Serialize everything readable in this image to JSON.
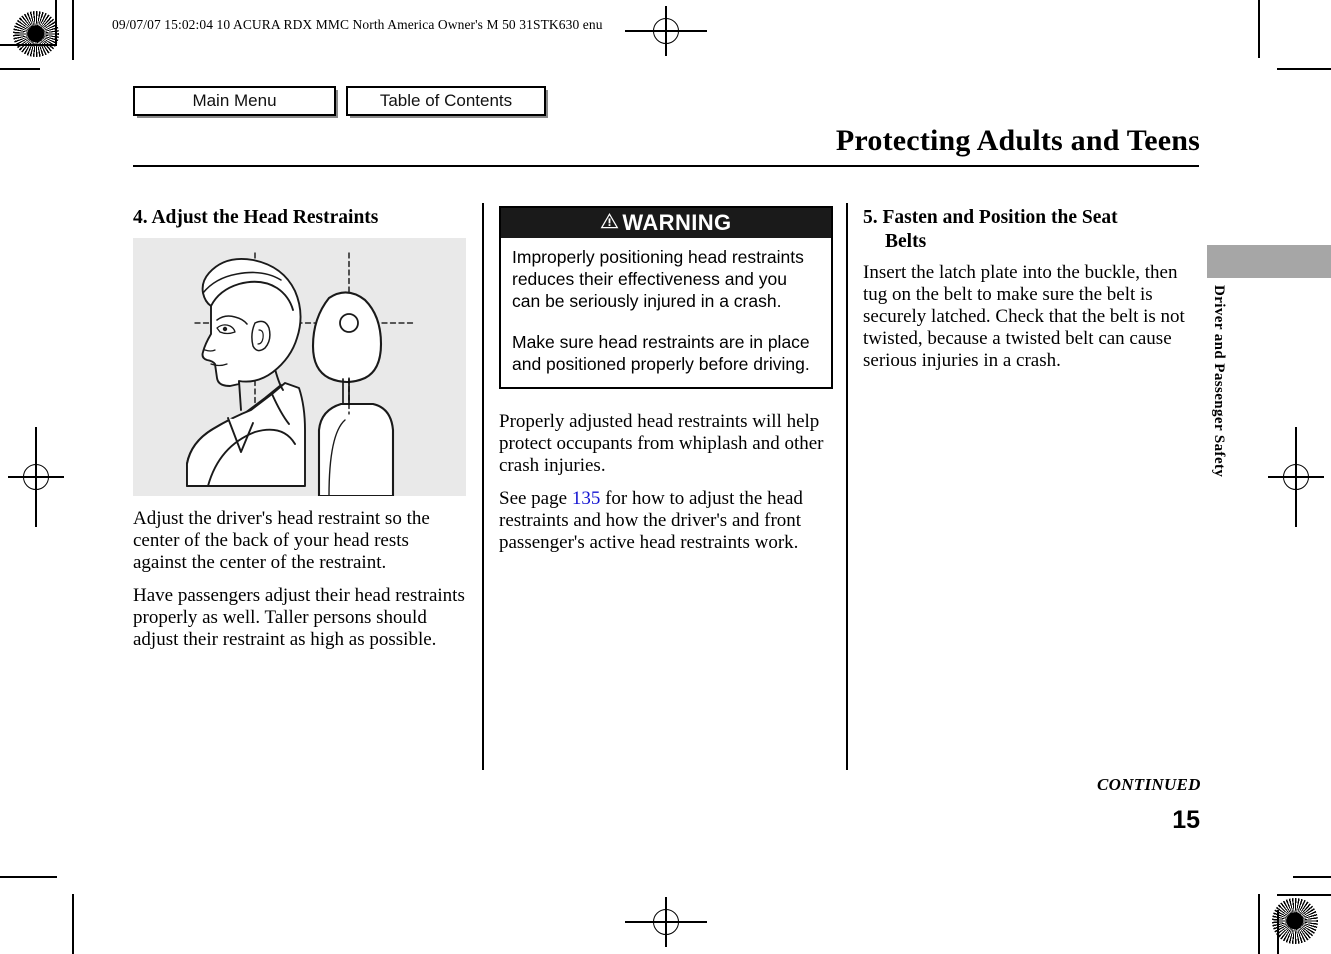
{
  "header": {
    "print_info": "09/07/07 15:02:04    10 ACURA RDX MMC North America Owner's M 50 31STK630 enu"
  },
  "nav": {
    "main_menu_label": "Main Menu",
    "table_of_contents_label": "Table of Contents"
  },
  "page": {
    "title": "Protecting Adults and Teens",
    "number": "15",
    "continued_label": "CONTINUED",
    "side_tab_label": "Driver and Passenger Safety",
    "side_tab_color": "#a6a6a6"
  },
  "left_column": {
    "heading_number": "4.",
    "heading_text": "Adjust the Head Restraints",
    "illustration_name": "head-restraint-alignment-diagram",
    "illustration_bg": "#e9e9e9",
    "paragraphs": [
      "Adjust the driver's head restraint so the center of the back of your head rests against the center of the restraint.",
      "Have passengers adjust their head restraints properly as well. Taller persons should adjust their restraint as high as possible."
    ]
  },
  "middle_column": {
    "warning": {
      "label": "WARNING",
      "bar_color": "#1a1a1a",
      "text_color": "#ffffff",
      "paragraphs": [
        "Improperly positioning head restraints reduces their effectiveness and you can be seriously injured in a crash.",
        "Make sure head restraints are in place and positioned properly before driving."
      ]
    },
    "paragraph_1": "Properly adjusted head restraints will help protect occupants from whiplash and other crash injuries.",
    "paragraph_2_before": "See page ",
    "paragraph_2_link": "135",
    "paragraph_2_after": " for how to adjust the head restraints and how the driver's and front passenger's active head restraints work.",
    "link_color": "#1414d2"
  },
  "right_column": {
    "heading_number": "5.",
    "heading_text": "Fasten and Position the Seat",
    "heading_text_line2": "Belts",
    "paragraph": "Insert the latch plate into the buckle, then tug on the belt to make sure the belt is securely latched. Check that the belt is not twisted, because a twisted belt can cause serious injuries in a crash."
  }
}
